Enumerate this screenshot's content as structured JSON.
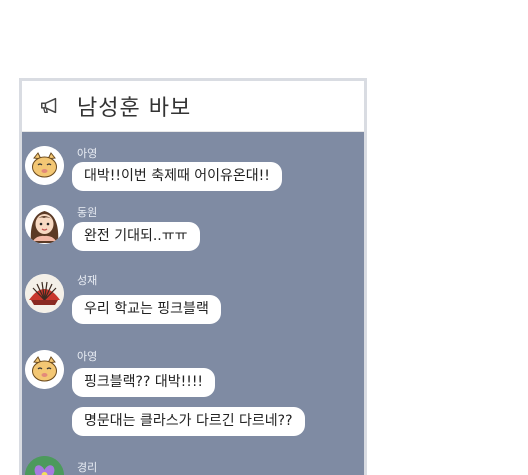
{
  "header": {
    "title": "남성훈 바보",
    "icon": "megaphone-icon"
  },
  "messages": [
    {
      "sender": "아영",
      "avatar": "cat-avatar",
      "bubbles": [
        "대박!!이번 축제때 어이유온대!!"
      ]
    },
    {
      "sender": "동원",
      "avatar": "girl-avatar",
      "bubbles": [
        "완전 기대되..ㅠㅠ"
      ]
    },
    {
      "sender": "성재",
      "avatar": "fan-avatar",
      "bubbles": [
        "우리 학교는 핑크블랙"
      ]
    },
    {
      "sender": "아영",
      "avatar": "cat-avatar",
      "bubbles": [
        "핑크블랙?? 대박!!!!",
        "명문대는 클라스가 다르긴 다르네??"
      ]
    },
    {
      "sender": "경리",
      "avatar": "flower-avatar",
      "bubbles": []
    }
  ],
  "colors": {
    "chat_background": "#7f8ba3",
    "bubble": "#ffffff",
    "header": "#ffffff"
  }
}
